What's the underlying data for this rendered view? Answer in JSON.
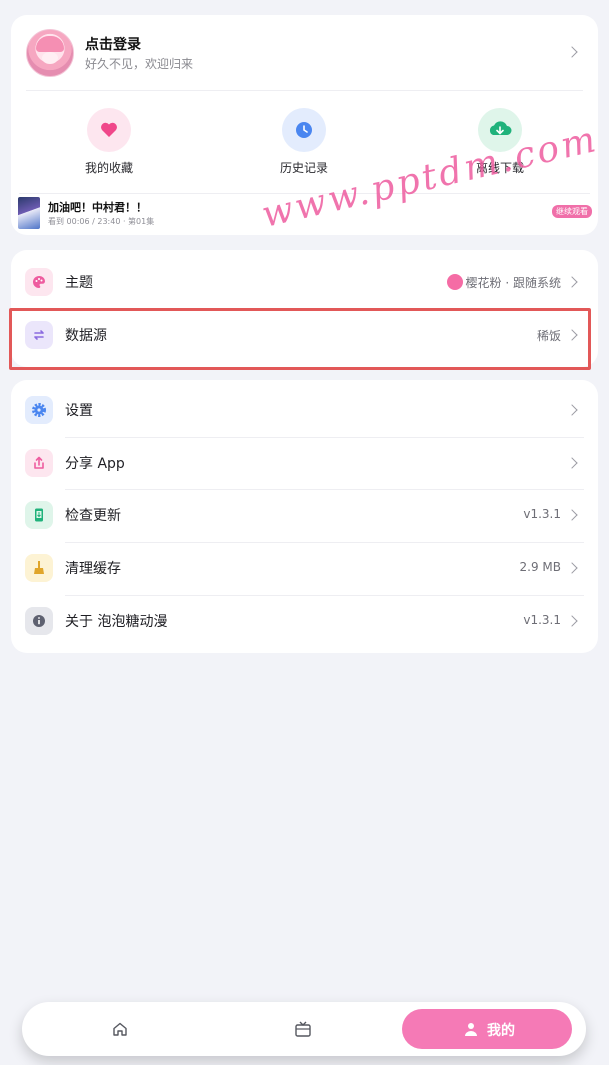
{
  "profile": {
    "title": "点击登录",
    "subtitle": "好久不见，欢迎归来"
  },
  "quick_actions": [
    {
      "label": "我的收藏",
      "icon": "heart-icon",
      "color": "#f0478a",
      "bg": "#fde6ef"
    },
    {
      "label": "历史记录",
      "icon": "clock-icon",
      "color": "#4a86f0",
      "bg": "#e3ecfd"
    },
    {
      "label": "离线下载",
      "icon": "cloud-download-icon",
      "color": "#1fb27b",
      "bg": "#dff5ea"
    }
  ],
  "continue_watching": {
    "title": "加油吧！中村君！！",
    "meta": "看到 00:06 / 23:40 · 第01集",
    "badge": "继续观看"
  },
  "watermark": "www.pptdm.com",
  "group1": [
    {
      "label": "主题",
      "value": "樱花粉 · 跟随系统",
      "icon": "palette-icon",
      "swatch": "#f56ca5"
    },
    {
      "label": "数据源",
      "value": "稀饭",
      "icon": "swap-icon"
    }
  ],
  "group2": [
    {
      "label": "设置",
      "value": "",
      "icon": "gear-icon"
    },
    {
      "label": "分享 App",
      "value": "",
      "icon": "share-icon"
    },
    {
      "label": "检查更新",
      "value": "v1.3.1",
      "icon": "update-icon"
    },
    {
      "label": "清理缓存",
      "value": "2.9 MB",
      "icon": "broom-icon"
    },
    {
      "label": "关于 泡泡糖动漫",
      "value": "v1.3.1",
      "icon": "info-icon"
    }
  ],
  "nav": {
    "home_icon": "home-icon",
    "tv_icon": "tv-icon",
    "me_label": "我的"
  },
  "colors": {
    "accent": "#f57ab6",
    "highlight_border": "#e25858"
  }
}
